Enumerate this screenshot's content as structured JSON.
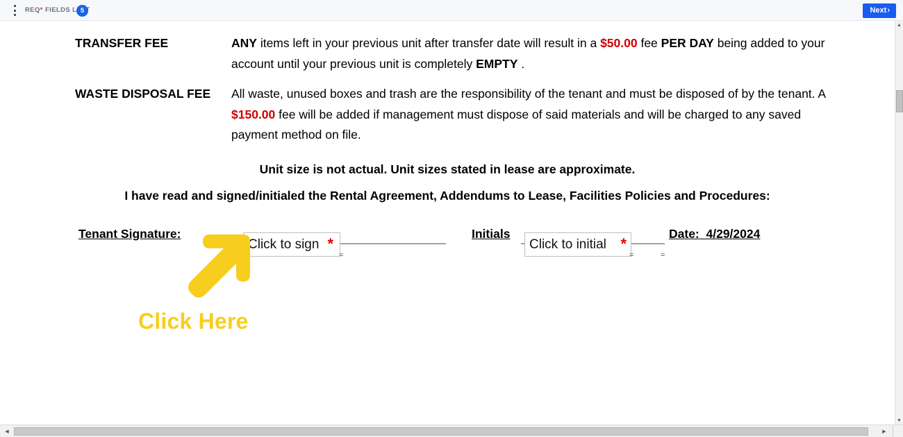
{
  "toolbar": {
    "menu_icon": "kebab-menu-icon",
    "req_fields_label_prefix": "REQ",
    "req_fields_label_star": "*",
    "req_fields_label_suffix": " FIELDS LEFT",
    "req_fields_count": "5",
    "next_label": "Next",
    "next_chevron": "›",
    "badge_color": "#1a63e8",
    "next_button_color": "#1a5cf0"
  },
  "document": {
    "clauses": [
      {
        "title": "TRANSFER FEE",
        "segments": [
          {
            "text": "ANY",
            "style": "bold"
          },
          {
            "text": " items left in your previous unit after transfer date will result in a ",
            "style": "normal"
          },
          {
            "text": "$50.00",
            "style": "red"
          },
          {
            "text": " fee ",
            "style": "normal"
          },
          {
            "text": "PER DAY",
            "style": "bold"
          },
          {
            "text": " being added to your account until your previous unit is completely ",
            "style": "normal"
          },
          {
            "text": "EMPTY",
            "style": "bold"
          },
          {
            "text": " .",
            "style": "normal"
          }
        ]
      },
      {
        "title": "WASTE DISPOSAL FEE",
        "segments": [
          {
            "text": "All waste, unused boxes and trash are the responsibility of the tenant and must be disposed of by the tenant.  A ",
            "style": "normal"
          },
          {
            "text": "$150.00",
            "style": "red"
          },
          {
            "text": " fee will be added if management must dispose of said materials and will be charged to any saved payment method on file.",
            "style": "normal"
          }
        ]
      }
    ],
    "centered_lines": [
      "Unit size is not actual. Unit sizes stated in lease are approximate.",
      "I have read and signed/initialed the Rental Agreement, Addendums to Lease, Facilities Policies and Procedures:"
    ]
  },
  "signature_row": {
    "tenant_label": "Tenant Signature:",
    "sign_field_placeholder": "Click to sign",
    "sign_field_required_marker": "*",
    "initials_label": "Initials",
    "initials_field_placeholder": "Click to initial",
    "initials_field_required_marker": "*",
    "date_label": "Date:",
    "date_value": "4/29/2024",
    "small_dash": "=",
    "required_marker_color": "#e60000"
  },
  "annotation": {
    "arrow_icon": "up-right-arrow-icon",
    "text": "Click Here",
    "color": "#f7ce1d"
  },
  "scrollbars": {
    "vertical_up": "▲",
    "vertical_down": "▼",
    "horizontal_left": "◀",
    "horizontal_right": "▶"
  }
}
